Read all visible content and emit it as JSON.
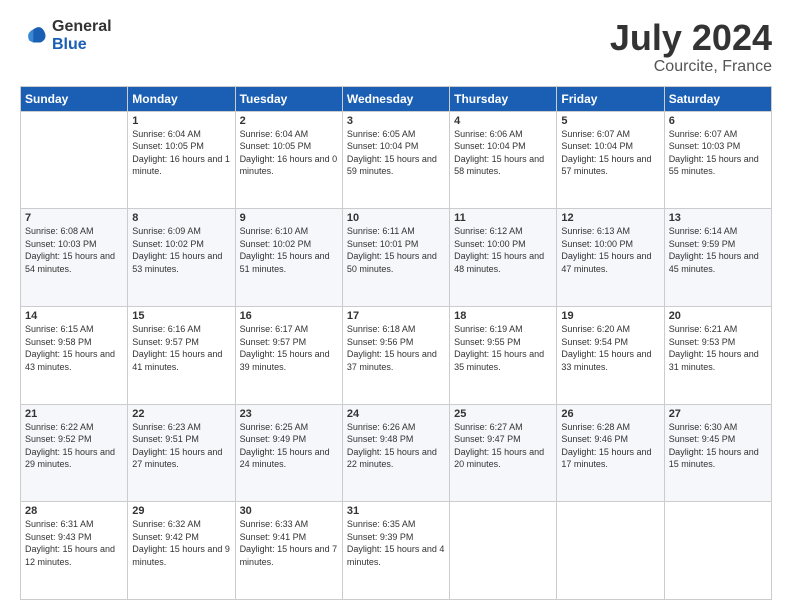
{
  "logo": {
    "general": "General",
    "blue": "Blue"
  },
  "title": {
    "month": "July 2024",
    "location": "Courcite, France"
  },
  "days_of_week": [
    "Sunday",
    "Monday",
    "Tuesday",
    "Wednesday",
    "Thursday",
    "Friday",
    "Saturday"
  ],
  "weeks": [
    [
      {
        "day": "",
        "sunrise": "",
        "sunset": "",
        "daylight": ""
      },
      {
        "day": "1",
        "sunrise": "Sunrise: 6:04 AM",
        "sunset": "Sunset: 10:05 PM",
        "daylight": "Daylight: 16 hours and 1 minute."
      },
      {
        "day": "2",
        "sunrise": "Sunrise: 6:04 AM",
        "sunset": "Sunset: 10:05 PM",
        "daylight": "Daylight: 16 hours and 0 minutes."
      },
      {
        "day": "3",
        "sunrise": "Sunrise: 6:05 AM",
        "sunset": "Sunset: 10:04 PM",
        "daylight": "Daylight: 15 hours and 59 minutes."
      },
      {
        "day": "4",
        "sunrise": "Sunrise: 6:06 AM",
        "sunset": "Sunset: 10:04 PM",
        "daylight": "Daylight: 15 hours and 58 minutes."
      },
      {
        "day": "5",
        "sunrise": "Sunrise: 6:07 AM",
        "sunset": "Sunset: 10:04 PM",
        "daylight": "Daylight: 15 hours and 57 minutes."
      },
      {
        "day": "6",
        "sunrise": "Sunrise: 6:07 AM",
        "sunset": "Sunset: 10:03 PM",
        "daylight": "Daylight: 15 hours and 55 minutes."
      }
    ],
    [
      {
        "day": "7",
        "sunrise": "Sunrise: 6:08 AM",
        "sunset": "Sunset: 10:03 PM",
        "daylight": "Daylight: 15 hours and 54 minutes."
      },
      {
        "day": "8",
        "sunrise": "Sunrise: 6:09 AM",
        "sunset": "Sunset: 10:02 PM",
        "daylight": "Daylight: 15 hours and 53 minutes."
      },
      {
        "day": "9",
        "sunrise": "Sunrise: 6:10 AM",
        "sunset": "Sunset: 10:02 PM",
        "daylight": "Daylight: 15 hours and 51 minutes."
      },
      {
        "day": "10",
        "sunrise": "Sunrise: 6:11 AM",
        "sunset": "Sunset: 10:01 PM",
        "daylight": "Daylight: 15 hours and 50 minutes."
      },
      {
        "day": "11",
        "sunrise": "Sunrise: 6:12 AM",
        "sunset": "Sunset: 10:00 PM",
        "daylight": "Daylight: 15 hours and 48 minutes."
      },
      {
        "day": "12",
        "sunrise": "Sunrise: 6:13 AM",
        "sunset": "Sunset: 10:00 PM",
        "daylight": "Daylight: 15 hours and 47 minutes."
      },
      {
        "day": "13",
        "sunrise": "Sunrise: 6:14 AM",
        "sunset": "Sunset: 9:59 PM",
        "daylight": "Daylight: 15 hours and 45 minutes."
      }
    ],
    [
      {
        "day": "14",
        "sunrise": "Sunrise: 6:15 AM",
        "sunset": "Sunset: 9:58 PM",
        "daylight": "Daylight: 15 hours and 43 minutes."
      },
      {
        "day": "15",
        "sunrise": "Sunrise: 6:16 AM",
        "sunset": "Sunset: 9:57 PM",
        "daylight": "Daylight: 15 hours and 41 minutes."
      },
      {
        "day": "16",
        "sunrise": "Sunrise: 6:17 AM",
        "sunset": "Sunset: 9:57 PM",
        "daylight": "Daylight: 15 hours and 39 minutes."
      },
      {
        "day": "17",
        "sunrise": "Sunrise: 6:18 AM",
        "sunset": "Sunset: 9:56 PM",
        "daylight": "Daylight: 15 hours and 37 minutes."
      },
      {
        "day": "18",
        "sunrise": "Sunrise: 6:19 AM",
        "sunset": "Sunset: 9:55 PM",
        "daylight": "Daylight: 15 hours and 35 minutes."
      },
      {
        "day": "19",
        "sunrise": "Sunrise: 6:20 AM",
        "sunset": "Sunset: 9:54 PM",
        "daylight": "Daylight: 15 hours and 33 minutes."
      },
      {
        "day": "20",
        "sunrise": "Sunrise: 6:21 AM",
        "sunset": "Sunset: 9:53 PM",
        "daylight": "Daylight: 15 hours and 31 minutes."
      }
    ],
    [
      {
        "day": "21",
        "sunrise": "Sunrise: 6:22 AM",
        "sunset": "Sunset: 9:52 PM",
        "daylight": "Daylight: 15 hours and 29 minutes."
      },
      {
        "day": "22",
        "sunrise": "Sunrise: 6:23 AM",
        "sunset": "Sunset: 9:51 PM",
        "daylight": "Daylight: 15 hours and 27 minutes."
      },
      {
        "day": "23",
        "sunrise": "Sunrise: 6:25 AM",
        "sunset": "Sunset: 9:49 PM",
        "daylight": "Daylight: 15 hours and 24 minutes."
      },
      {
        "day": "24",
        "sunrise": "Sunrise: 6:26 AM",
        "sunset": "Sunset: 9:48 PM",
        "daylight": "Daylight: 15 hours and 22 minutes."
      },
      {
        "day": "25",
        "sunrise": "Sunrise: 6:27 AM",
        "sunset": "Sunset: 9:47 PM",
        "daylight": "Daylight: 15 hours and 20 minutes."
      },
      {
        "day": "26",
        "sunrise": "Sunrise: 6:28 AM",
        "sunset": "Sunset: 9:46 PM",
        "daylight": "Daylight: 15 hours and 17 minutes."
      },
      {
        "day": "27",
        "sunrise": "Sunrise: 6:30 AM",
        "sunset": "Sunset: 9:45 PM",
        "daylight": "Daylight: 15 hours and 15 minutes."
      }
    ],
    [
      {
        "day": "28",
        "sunrise": "Sunrise: 6:31 AM",
        "sunset": "Sunset: 9:43 PM",
        "daylight": "Daylight: 15 hours and 12 minutes."
      },
      {
        "day": "29",
        "sunrise": "Sunrise: 6:32 AM",
        "sunset": "Sunset: 9:42 PM",
        "daylight": "Daylight: 15 hours and 9 minutes."
      },
      {
        "day": "30",
        "sunrise": "Sunrise: 6:33 AM",
        "sunset": "Sunset: 9:41 PM",
        "daylight": "Daylight: 15 hours and 7 minutes."
      },
      {
        "day": "31",
        "sunrise": "Sunrise: 6:35 AM",
        "sunset": "Sunset: 9:39 PM",
        "daylight": "Daylight: 15 hours and 4 minutes."
      },
      {
        "day": "",
        "sunrise": "",
        "sunset": "",
        "daylight": ""
      },
      {
        "day": "",
        "sunrise": "",
        "sunset": "",
        "daylight": ""
      },
      {
        "day": "",
        "sunrise": "",
        "sunset": "",
        "daylight": ""
      }
    ]
  ]
}
